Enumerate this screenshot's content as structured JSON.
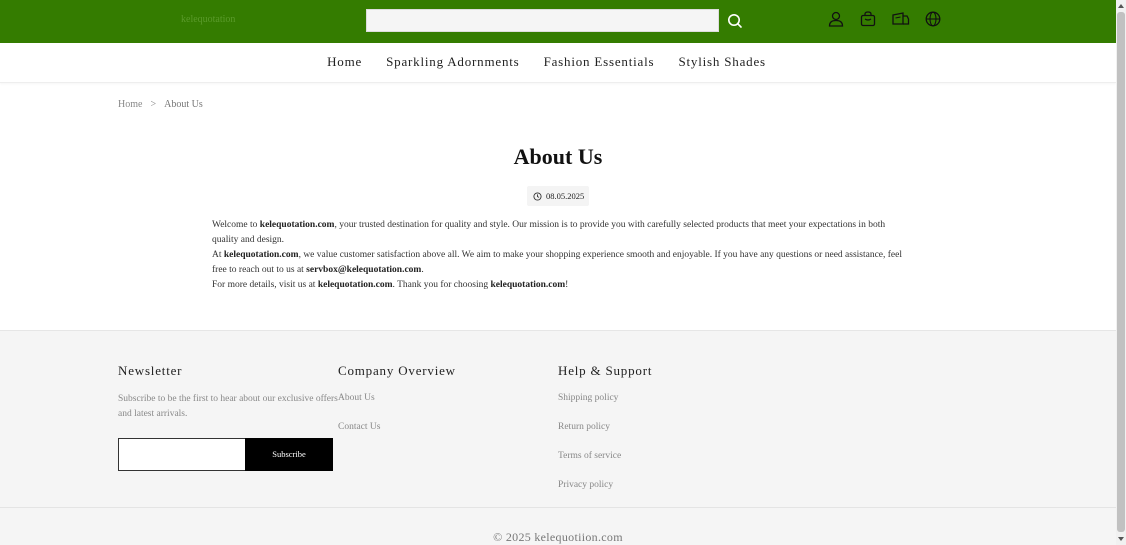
{
  "header": {
    "logo_text": "kelequotation",
    "search": {
      "value": "",
      "placeholder": ""
    },
    "icons": [
      "search-icon",
      "user-icon",
      "bag-icon",
      "truck-icon",
      "globe-icon"
    ],
    "brand_color": "#347c00"
  },
  "nav": {
    "items": [
      {
        "label": "Home"
      },
      {
        "label": "Sparkling Adornments"
      },
      {
        "label": "Fashion Essentials"
      },
      {
        "label": "Stylish Shades"
      }
    ]
  },
  "breadcrumb": {
    "home": "Home",
    "separator": ">",
    "current": "About Us"
  },
  "article": {
    "title": "About Us",
    "date": "08.05.2025",
    "p1_a": "Welcome to ",
    "p1_b": "kelequotation.com",
    "p1_c": ", your trusted destination for quality and style. Our mission is to provide you with carefully selected products that meet your expectations in both quality and design.",
    "p2_a": "At ",
    "p2_b": "kelequotation.com",
    "p2_c": ", we value customer satisfaction above all. We aim to make your shopping experience smooth and enjoyable. If you have any questions or need assistance, feel free to reach out to us at ",
    "p2_d": "servbox@kelequotation.com",
    "p2_e": ".",
    "p3_a": "For more details, visit us at ",
    "p3_b": "kelequotation.com",
    "p3_c": ". Thank you for choosing ",
    "p3_d": "kelequotation.com",
    "p3_e": "!"
  },
  "footer": {
    "newsletter": {
      "title": "Newsletter",
      "text_line1": "Subscribe to be the first to hear about our exclusive offers",
      "text_line2": "and latest arrivals.",
      "input_value": "",
      "button_label": "Subscribe"
    },
    "company": {
      "title": "Company Overview",
      "links": [
        {
          "label": "About Us"
        },
        {
          "label": "Contact Us"
        }
      ]
    },
    "help": {
      "title": "Help & Support",
      "links": [
        {
          "label": "Shipping policy"
        },
        {
          "label": "Return policy"
        },
        {
          "label": "Terms of service"
        },
        {
          "label": "Privacy policy"
        }
      ]
    },
    "copyright": "© 2025 kelequotiion.com"
  }
}
